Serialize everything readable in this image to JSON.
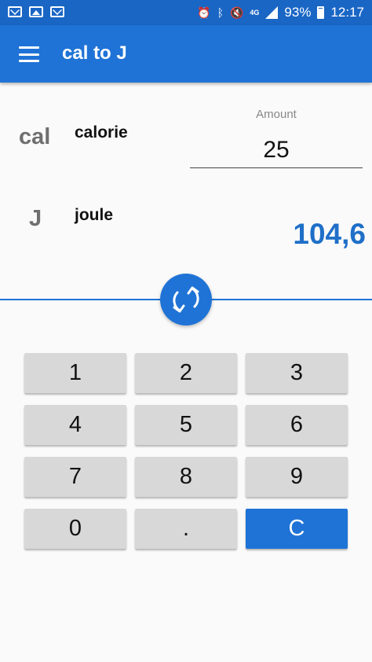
{
  "status_bar": {
    "network": "4G",
    "battery": "93%",
    "time": "12:17",
    "icons": [
      "mail-icon",
      "image-icon",
      "mail-icon",
      "alarm-icon",
      "bluetooth-icon",
      "mute-icon",
      "signal-icon",
      "battery-icon"
    ]
  },
  "app_bar": {
    "title": "cal to J"
  },
  "converter": {
    "from": {
      "symbol": "cal",
      "name": "calorie"
    },
    "to": {
      "symbol": "J",
      "name": "joule"
    },
    "amount_label": "Amount",
    "amount_value": "25",
    "result": "104,6"
  },
  "keypad": {
    "k1": "1",
    "k2": "2",
    "k3": "3",
    "k4": "4",
    "k5": "5",
    "k6": "6",
    "k7": "7",
    "k8": "8",
    "k9": "9",
    "k0": "0",
    "dot": ".",
    "clear": "C"
  },
  "colors": {
    "primary": "#1f73d6",
    "status_bar": "#1a66c5",
    "result": "#1f6fc8",
    "key": "#d8d8d8"
  }
}
